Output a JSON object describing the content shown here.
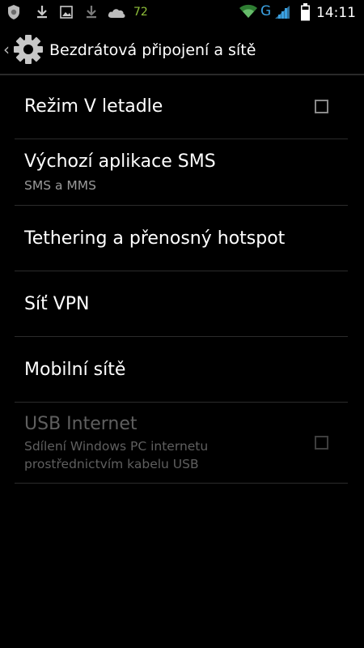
{
  "status_bar": {
    "battery_level": "72",
    "network_type": "G",
    "time": "14:11",
    "icons": [
      "shield-icon",
      "download-icon",
      "image-icon",
      "download-icon",
      "cloud-icon",
      "wifi-icon",
      "signal-icon",
      "battery-icon"
    ],
    "colors": {
      "battery_text": "#8fbf3a",
      "wifi": "#4caf50",
      "network": "#3aa0e0"
    }
  },
  "action_bar": {
    "title": "Bezdrátová připojení a sítě",
    "icon": "gear-icon"
  },
  "settings": {
    "items": [
      {
        "title": "Režim V letadle",
        "checkbox": true,
        "checked": false,
        "enabled": true
      },
      {
        "title": "Výchozí aplikace SMS",
        "summary": "SMS a MMS",
        "enabled": true
      },
      {
        "title": "Tethering a přenosný hotspot",
        "enabled": true
      },
      {
        "title": "Síť VPN",
        "enabled": true
      },
      {
        "title": "Mobilní sítě",
        "enabled": true
      },
      {
        "title": "USB Internet",
        "summary": "Sdílení Windows PC internetu prostřednictvím kabelu USB",
        "checkbox": true,
        "checked": false,
        "enabled": false
      }
    ]
  }
}
